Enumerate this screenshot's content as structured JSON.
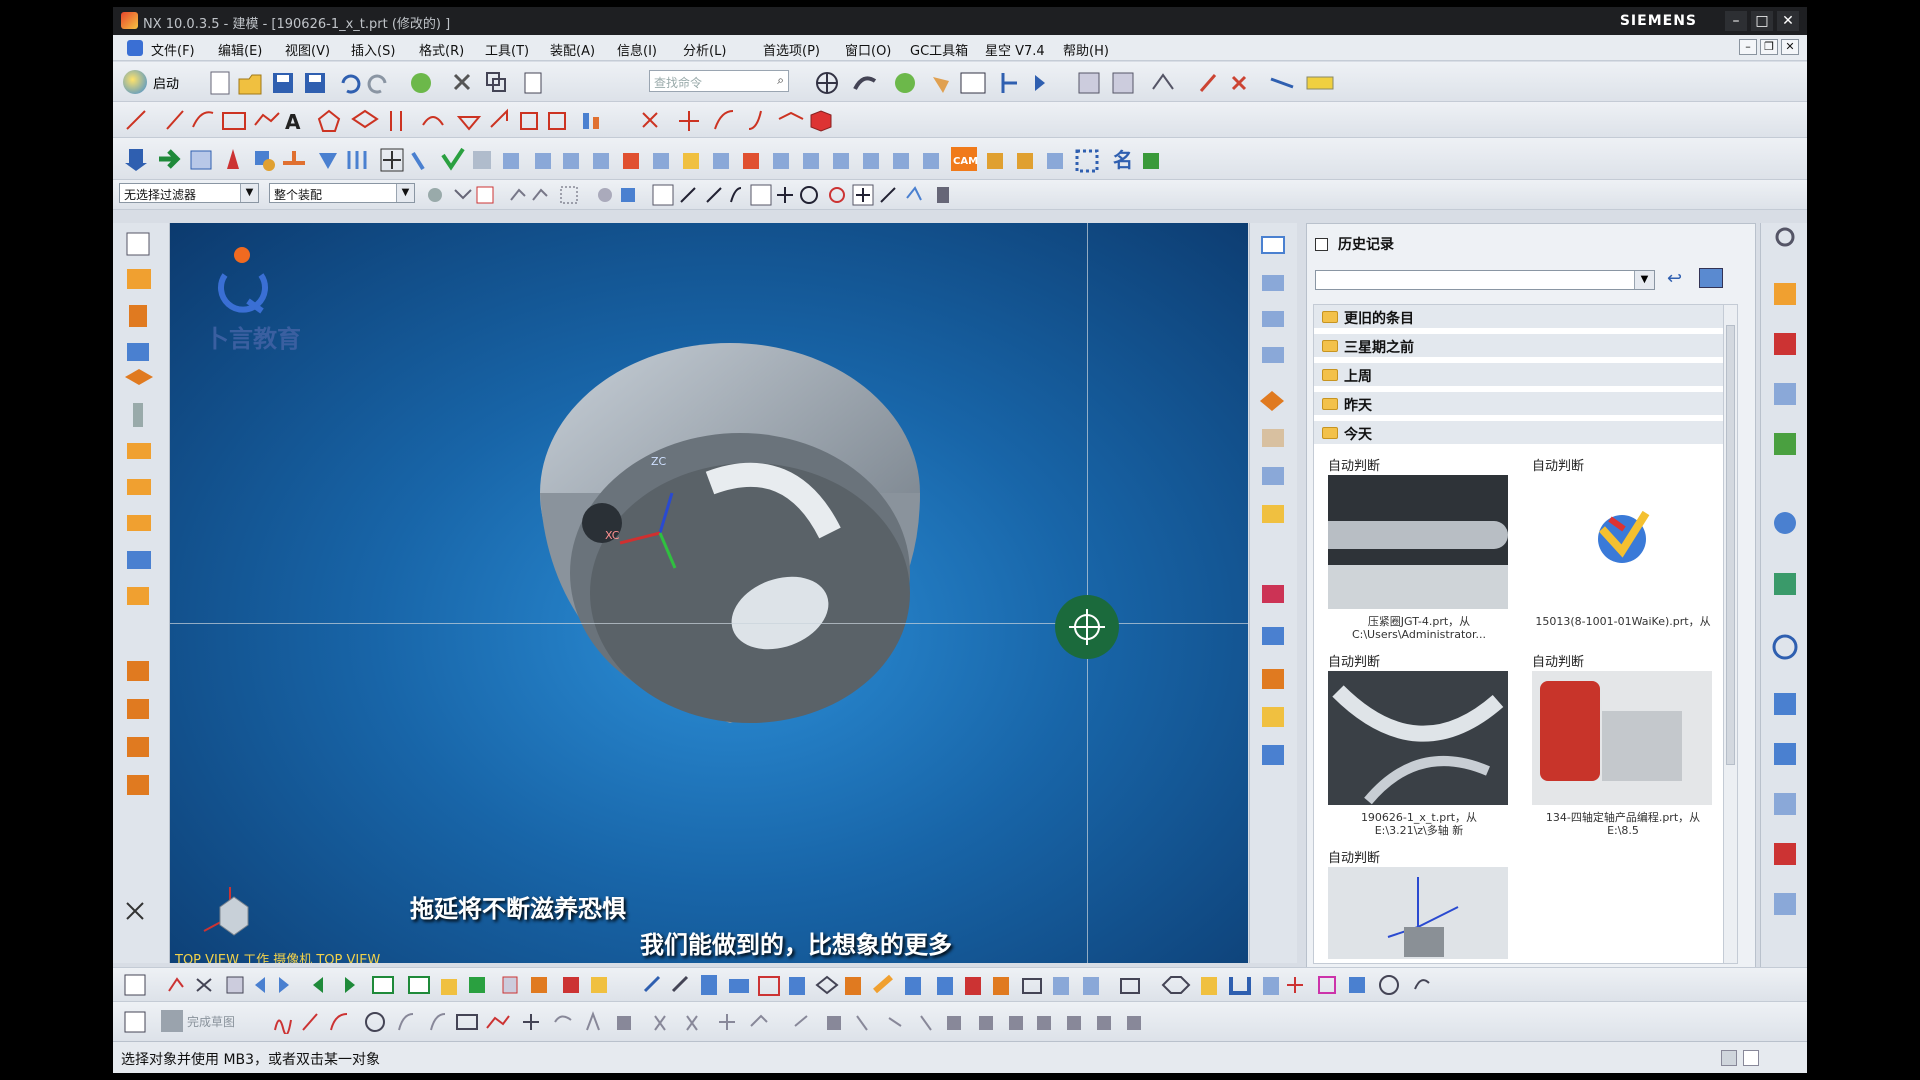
{
  "window": {
    "title": "NX 10.0.3.5 - 建模 - [190626-1_x_t.prt  (修改的) ]",
    "brand": "SIEMENS"
  },
  "menubar": {
    "items": [
      "文件(F)",
      "编辑(E)",
      "视图(V)",
      "插入(S)",
      "格式(R)",
      "工具(T)",
      "装配(A)",
      "信息(I)",
      "分析(L)",
      "首选项(P)",
      "窗口(O)",
      "GC工具箱",
      "星空 V7.4",
      "帮助(H)"
    ]
  },
  "toolbar": {
    "start_label": "启动",
    "search_placeholder": "查找命令"
  },
  "filterbar": {
    "selection_filter": "无选择过滤器",
    "scope": "整个装配"
  },
  "history": {
    "title": "历史记录",
    "folders": [
      "更旧的条目",
      "三星期之前",
      "上周",
      "昨天",
      "今天"
    ],
    "cards": [
      {
        "label": "自动判断",
        "caption": "压紧圈JGT-4.prt，从 C:\\Users\\Administrator..."
      },
      {
        "label": "自动判断",
        "caption": "15013(8-1001-01WaiKe).prt，从"
      },
      {
        "label": "自动判断",
        "caption": "190626-1_x_t.prt，从 E:\\3.21\\z\\多轴 新"
      },
      {
        "label": "自动判断",
        "caption": "134-四轴定轴产品编程.prt，从 E:\\8.5"
      },
      {
        "label": "自动判断",
        "caption": ""
      }
    ]
  },
  "viewport": {
    "watermark": "卜言教育",
    "axis_zc": "ZC",
    "axis_xc": "XC",
    "subtitle_1": "拖延将不断滋养恐惧",
    "subtitle_2": "我们能做到的，比想象的更多",
    "view_label": "TOP VIEW 工作 摄像机 TOP VIEW"
  },
  "bottom_toolbar": {
    "finish_sketch": "完成草图"
  },
  "status": {
    "text": "选择对象并使用 MB3，或者双击某一对象"
  },
  "colors": {
    "accent": "#3a6fd4",
    "viewport": "#1865a8",
    "title_bar": "#1e1f22"
  }
}
